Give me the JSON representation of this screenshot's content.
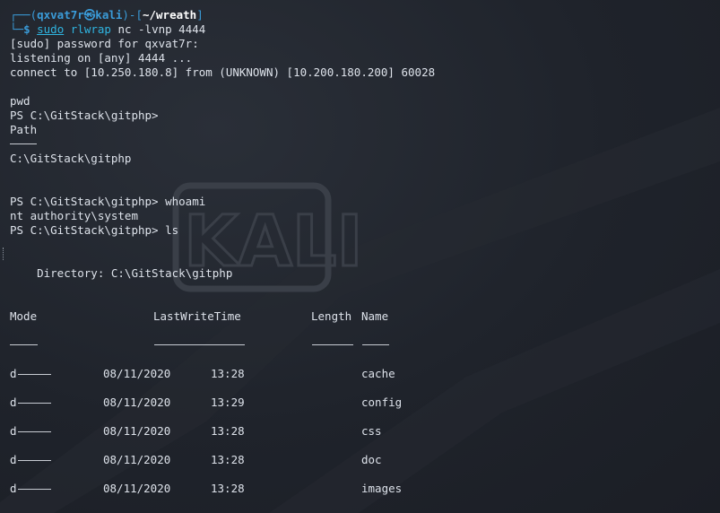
{
  "prompt": {
    "frame_left": "┌──(",
    "user_host": "qxvat7r㉿kali",
    "frame_mid": ")-[",
    "cwd": "~/wreath",
    "frame_right": "]",
    "frame_bottom": "└─",
    "dollar": "$",
    "cmd_sudo": "sudo",
    "cmd_tool": "rlwrap",
    "cmd_args": "nc -lvnp 4444"
  },
  "output": {
    "sudo_prompt": "[sudo] password for qxvat7r:",
    "listening": "listening on [any] 4444 ...",
    "connect": "connect to [10.250.180.8] from (UNKNOWN) [10.200.180.200] 60028",
    "pwd_cmd": "pwd",
    "ps_prompt1": "PS C:\\GitStack\\gitphp>",
    "path_header": "Path",
    "path_value": "C:\\GitStack\\gitphp",
    "ps_whoami": "PS C:\\GitStack\\gitphp> whoami",
    "whoami_result": "nt authority\\system",
    "ps_ls": "PS C:\\GitStack\\gitphp> ls",
    "directory": "    Directory: C:\\GitStack\\gitphp"
  },
  "listing": {
    "headers": {
      "mode": "Mode",
      "time": "LastWriteTime",
      "length": "Length",
      "name": "Name"
    },
    "rows": [
      {
        "mode": "d",
        "date": "08/11/2020",
        "time": "13:28",
        "name": "cache"
      },
      {
        "mode": "d",
        "date": "08/11/2020",
        "time": "13:29",
        "name": "config"
      },
      {
        "mode": "d",
        "date": "08/11/2020",
        "time": "13:28",
        "name": "css"
      },
      {
        "mode": "d",
        "date": "08/11/2020",
        "time": "13:28",
        "name": "doc"
      },
      {
        "mode": "d",
        "date": "08/11/2020",
        "time": "13:28",
        "name": "images"
      }
    ]
  },
  "watermark": {
    "text": "KALI",
    "color": "#3a3f48"
  },
  "colors": {
    "background": "#1f232b",
    "prompt_blue": "#3a9bd8",
    "command_cyan": "#2fb4e0",
    "text": "#dde2ea"
  }
}
